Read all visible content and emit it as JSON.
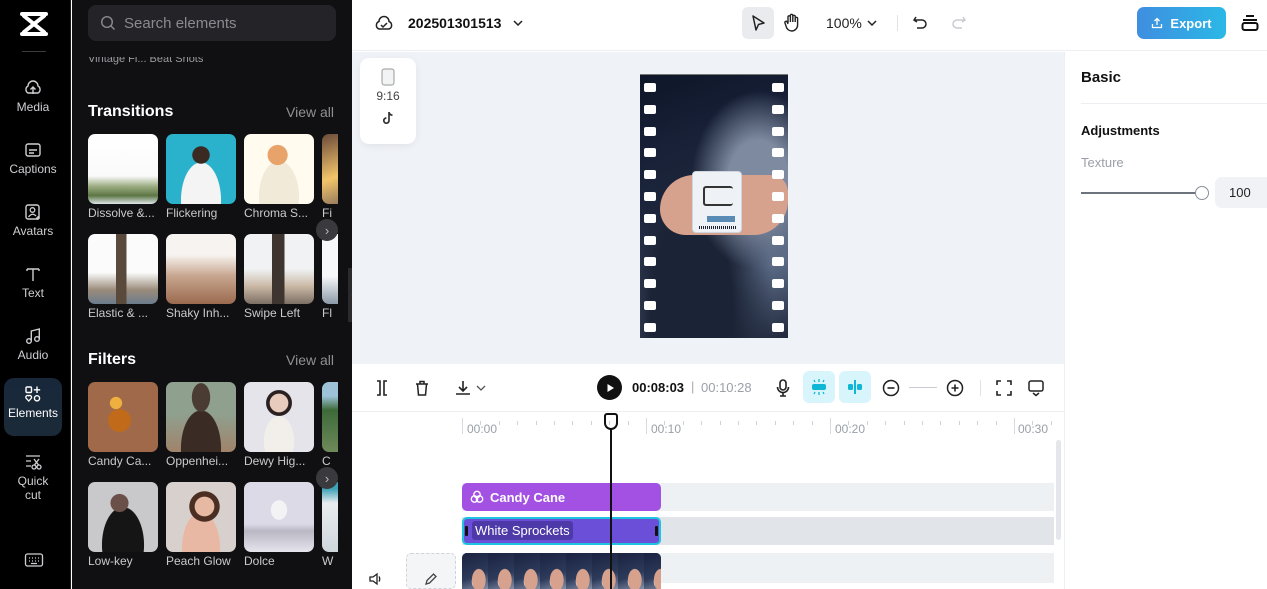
{
  "rail": {
    "items": [
      {
        "label": "Media",
        "icon": "cloud-upload-icon"
      },
      {
        "label": "Captions",
        "icon": "captions-icon"
      },
      {
        "label": "Avatars",
        "icon": "avatar-icon"
      },
      {
        "label": "Text",
        "icon": "text-icon"
      },
      {
        "label": "Audio",
        "icon": "music-note-icon"
      },
      {
        "label": "Elements",
        "icon": "elements-icon",
        "active": true
      },
      {
        "label": "Quick cut",
        "icon": "scissors-icon"
      }
    ],
    "bottom_icon": "keyboard-icon"
  },
  "panel": {
    "search_placeholder": "Search elements",
    "cut_row": "Vintage Fi...    Beat Shots",
    "transitions": {
      "title": "Transitions",
      "view_all": "View all",
      "items": [
        "Dissolve &...",
        "Flickering",
        "Chroma S...",
        "Fi",
        "Elastic & ...",
        "Shaky Inh...",
        "Swipe Left",
        "Fl"
      ]
    },
    "filters": {
      "title": "Filters",
      "view_all": "View all",
      "items": [
        "Candy Ca...",
        "Oppenhei...",
        "Dewy Hig...",
        "C",
        "Low-key",
        "Peach Glow",
        "Dolce",
        "W"
      ]
    }
  },
  "topbar": {
    "project_name": "202501301513",
    "zoom": "100%",
    "export_label": "Export"
  },
  "canvas": {
    "ratio_label": "9:16"
  },
  "right_panel": {
    "title": "Basic",
    "section": "Adjustments",
    "texture_label": "Texture",
    "texture_value": "100",
    "texture_fraction": 1.0
  },
  "timeline_toolbar": {
    "current_time": "00:08:03",
    "separator": "|",
    "total_time": "00:10:28"
  },
  "timeline": {
    "ruler": [
      "00:00",
      "00:10",
      "00:20",
      "00:30"
    ],
    "clips": {
      "filter": "Candy Cane",
      "effect": "White Sprockets"
    }
  }
}
